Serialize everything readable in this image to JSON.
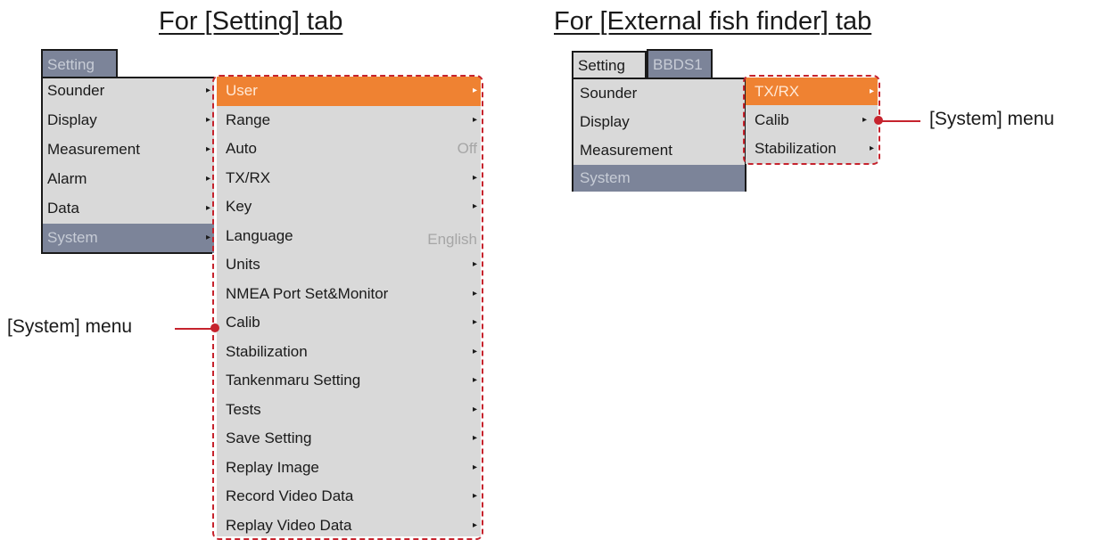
{
  "left": {
    "heading": "For [Setting] tab",
    "tab": "Setting",
    "menu": [
      {
        "label": "Sounder",
        "arrow": "▸"
      },
      {
        "label": "Display",
        "arrow": "▸"
      },
      {
        "label": "Measurement",
        "arrow": "▸"
      },
      {
        "label": "Alarm",
        "arrow": "▸"
      },
      {
        "label": "Data",
        "arrow": "▸"
      },
      {
        "label": "System",
        "arrow": "▸",
        "selected": true
      }
    ],
    "submenu": [
      {
        "label": "User",
        "arrow": "▸",
        "highlighted": true
      },
      {
        "label": "Range",
        "arrow": "▸"
      },
      {
        "label": "Auto",
        "value": "Off"
      },
      {
        "label": "TX/RX",
        "arrow": "▸"
      },
      {
        "label": "Key",
        "arrow": "▸"
      },
      {
        "label": "Language",
        "value": "English"
      },
      {
        "label": "Units",
        "arrow": "▸"
      },
      {
        "label": "NMEA Port Set&Monitor",
        "arrow": "▸"
      },
      {
        "label": "Calib",
        "arrow": "▸"
      },
      {
        "label": "Stabilization",
        "arrow": "▸"
      },
      {
        "label": "Tankenmaru Setting",
        "arrow": "▸"
      },
      {
        "label": "Tests",
        "arrow": "▸"
      },
      {
        "label": "Save Setting",
        "arrow": "▸"
      },
      {
        "label": "Replay Image",
        "arrow": "▸"
      },
      {
        "label": "Record Video Data",
        "arrow": "▸"
      },
      {
        "label": "Replay Video Data",
        "arrow": "▸"
      }
    ],
    "callout": "[System] menu"
  },
  "right": {
    "heading": "For [External fish finder] tab",
    "tabs": [
      "Setting",
      "BBDS1"
    ],
    "menu": [
      {
        "label": "Sounder"
      },
      {
        "label": "Display"
      },
      {
        "label": "Measurement"
      },
      {
        "label": "System",
        "selected": true
      }
    ],
    "submenu": [
      {
        "label": "TX/RX",
        "arrow": "▸",
        "highlighted": true
      },
      {
        "label": "Calib",
        "arrow": "▸"
      },
      {
        "label": "Stabilization",
        "arrow": "▸"
      }
    ],
    "callout": "[System] menu"
  },
  "colors": {
    "menu_bg": "#d9d9d9",
    "selected_bg": "#7c8499",
    "highlight_bg": "#ef8232",
    "callout_red": "#c6232d"
  }
}
